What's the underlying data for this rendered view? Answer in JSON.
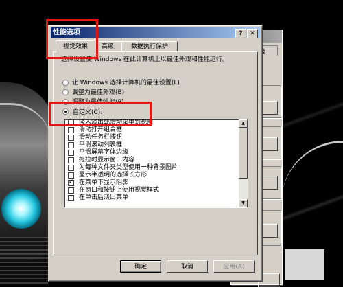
{
  "dialog": {
    "title": "性能选项",
    "help_glyph": "?",
    "close_glyph": "✕",
    "tabs": [
      {
        "label": "视觉效果"
      },
      {
        "label": "高级"
      },
      {
        "label": "数据执行保护"
      }
    ],
    "description": "选择设置使 Windows 在此计算机上以最佳外观和性能运行。",
    "radios": [
      {
        "label": "让 Windows 选择计算机的最佳设置(L)",
        "selected": false
      },
      {
        "label": "调整为最佳外观(B)",
        "selected": false
      },
      {
        "label": "调整为最佳性能(P)",
        "selected": false
      },
      {
        "label": "自定义(C):",
        "selected": true
      }
    ],
    "list_items": [
      {
        "label": "淡入淡出或滑动菜单到视图",
        "checked": false
      },
      {
        "label": "滑动打开组合框",
        "checked": false
      },
      {
        "label": "滑动任务栏按钮",
        "checked": false
      },
      {
        "label": "平滑滚动列表框",
        "checked": false
      },
      {
        "label": "平滑屏幕字体边缘",
        "checked": false
      },
      {
        "label": "拖拉时显示窗口内容",
        "checked": false
      },
      {
        "label": "为每种文件夹类型使用一种背景图片",
        "checked": false
      },
      {
        "label": "显示半透明的选择长方形",
        "checked": false
      },
      {
        "label": "在菜单下显示阴影",
        "checked": true
      },
      {
        "label": "在窗口和按钮上使用视觉样式",
        "checked": false
      },
      {
        "label": "在单击后淡出菜单",
        "checked": false
      }
    ],
    "buttons": {
      "ok": "确定",
      "cancel": "取消",
      "apply": "应用(A)"
    }
  },
  "background_dialog": {
    "tab_label": "级"
  },
  "colors": {
    "highlight": "#e8150f",
    "titlebar_start": "#0a246a",
    "titlebar_end": "#a6caf0",
    "face": "#d4d0c8"
  }
}
